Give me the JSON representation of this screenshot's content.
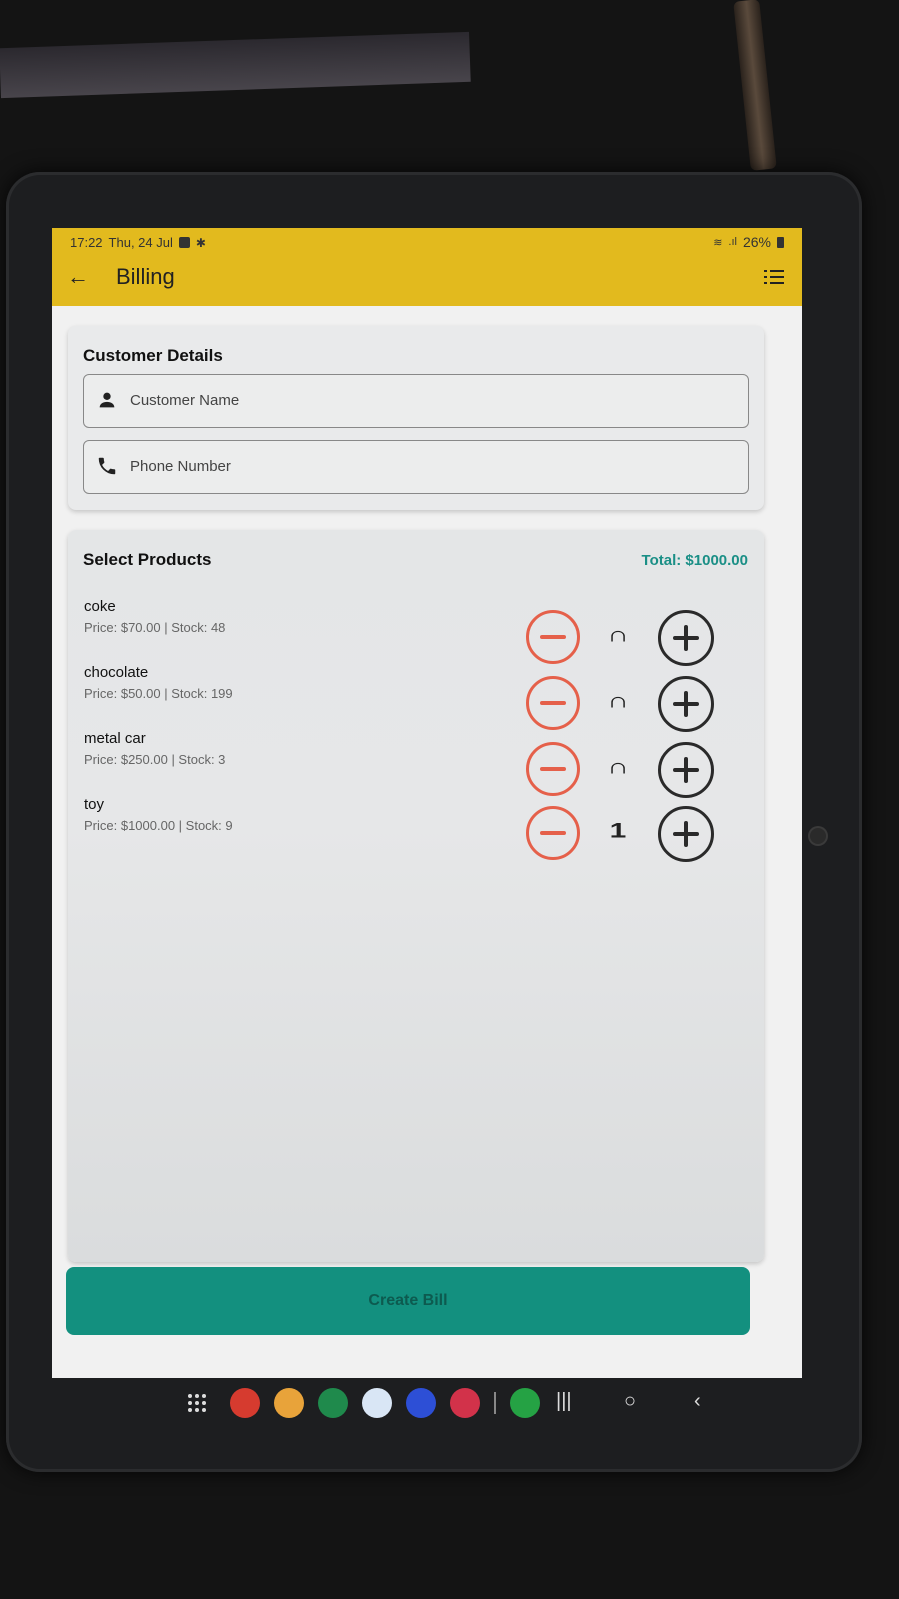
{
  "status": {
    "time": "17:22",
    "date": "Thu, 24 Jul",
    "battery": "26%"
  },
  "appbar": {
    "title": "Billing"
  },
  "customer": {
    "section_title": "Customer Details",
    "name_placeholder": "Customer Name",
    "phone_placeholder": "Phone Number"
  },
  "products": {
    "section_title": "Select Products",
    "total": "Total: $1000.00",
    "items": [
      {
        "name": "coke",
        "meta": "Price: $70.00 | Stock: 48",
        "qty": "∩"
      },
      {
        "name": "chocolate",
        "meta": "Price: $50.00 | Stock: 199",
        "qty": "∩"
      },
      {
        "name": "metal car",
        "meta": "Price: $250.00 | Stock: 3",
        "qty": "∩"
      },
      {
        "name": "toy",
        "meta": "Price: $1000.00 | Stock: 9",
        "qty": "1"
      }
    ]
  },
  "actions": {
    "create_bill": "Create Bill"
  },
  "colors": {
    "appbar": "#e2ba1e",
    "accent": "#13907f",
    "total_text": "#1a8f86",
    "minus": "#e5604a",
    "plus": "#2a2a2a"
  },
  "icons": {
    "back": "arrow-left-icon",
    "menu": "list-icon",
    "person": "person-icon",
    "phone": "phone-icon"
  }
}
